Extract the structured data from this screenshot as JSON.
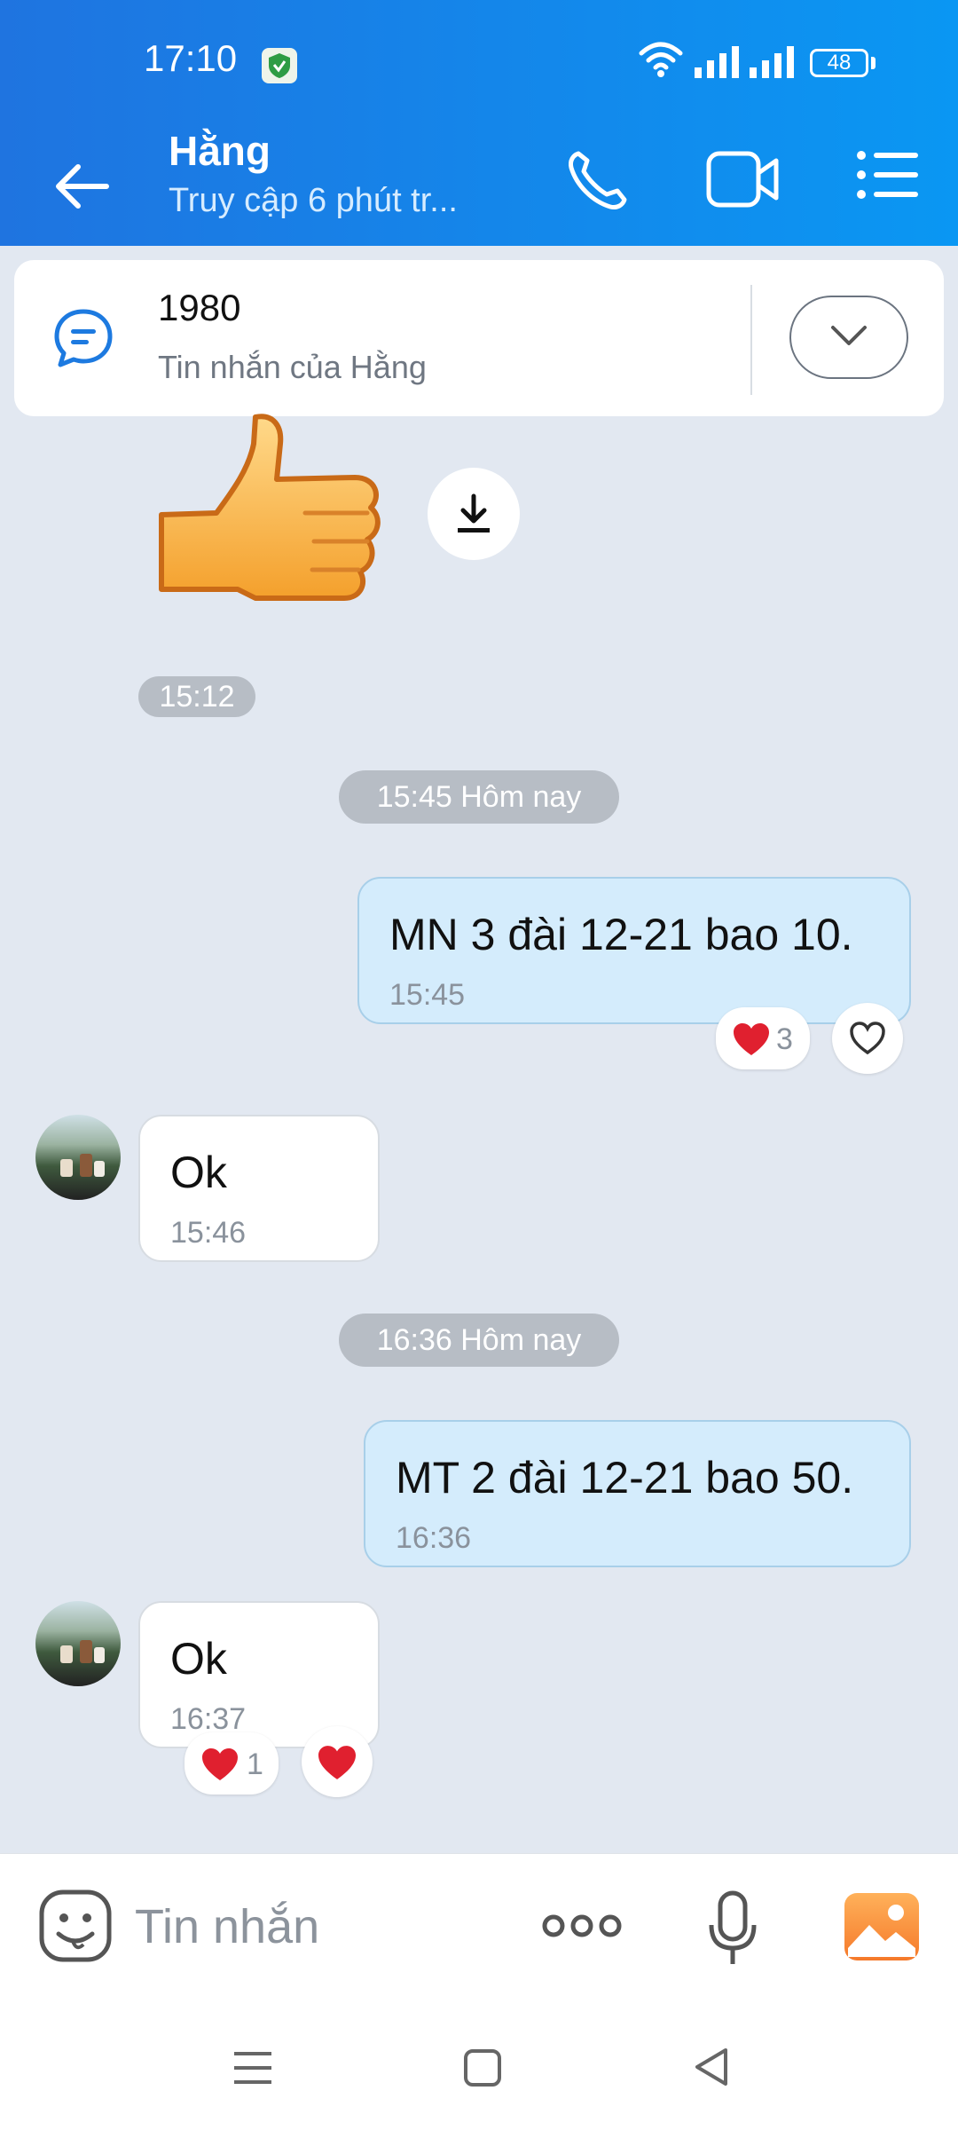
{
  "status_bar": {
    "time": "17:10",
    "battery": "48"
  },
  "header": {
    "name": "Hằng",
    "status": "Truy cập 6 phút tr..."
  },
  "pinned": {
    "title": "1980",
    "subtitle": "Tin nhắn của Hằng"
  },
  "messages": {
    "sticker_time": "15:12",
    "date_sep_1": "15:45 Hôm nay",
    "out_1": {
      "text": "MN 3 đài 12-21 bao 10.",
      "time": "15:45",
      "reaction_count": "3"
    },
    "in_1": {
      "text": "Ok",
      "time": "15:46"
    },
    "date_sep_2": "16:36 Hôm nay",
    "out_2": {
      "text": "MT 2 đài 12-21 bao 50.",
      "time": "16:36"
    },
    "in_2": {
      "text": "Ok",
      "time": "16:37",
      "reaction_count": "1"
    }
  },
  "input": {
    "placeholder": "Tin nhắn"
  },
  "colors": {
    "header": "#1f74e0",
    "outgoing_bubble": "#d4ecfc",
    "heart": "#e0202f",
    "background": "#e2e8f1"
  }
}
